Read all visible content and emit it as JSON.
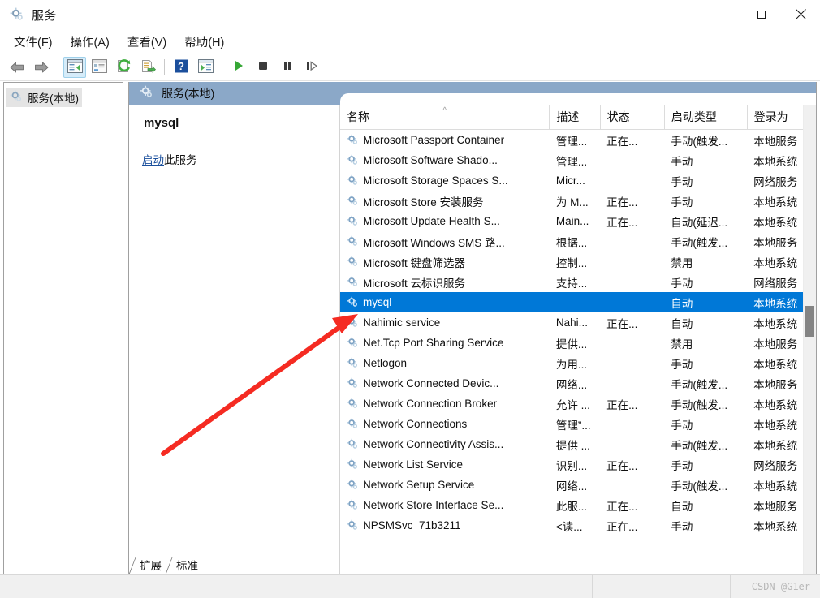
{
  "window": {
    "title": "服务",
    "icon": "services-gear-icon",
    "controls": {
      "minimize": "minimize-icon",
      "maximize": "maximize-icon",
      "close": "close-icon"
    }
  },
  "menubar": {
    "items": [
      {
        "label": "文件(F)",
        "name": "menu-file"
      },
      {
        "label": "操作(A)",
        "name": "menu-action"
      },
      {
        "label": "查看(V)",
        "name": "menu-view"
      },
      {
        "label": "帮助(H)",
        "name": "menu-help"
      }
    ]
  },
  "toolbar": {
    "buttons": [
      {
        "name": "back-button",
        "icon": "arrow-left-icon",
        "active": false
      },
      {
        "name": "forward-button",
        "icon": "arrow-right-icon",
        "active": false
      },
      {
        "name": "show-hide-tree-button",
        "icon": "console-tree-icon",
        "active": true
      },
      {
        "name": "properties-button",
        "icon": "properties-window-icon",
        "active": false
      },
      {
        "name": "refresh-button",
        "icon": "refresh-icon",
        "active": false
      },
      {
        "name": "export-list-button",
        "icon": "export-list-icon",
        "active": false
      },
      {
        "name": "help-button",
        "icon": "question-mark-icon",
        "active": false
      },
      {
        "name": "show-action-pane-button",
        "icon": "action-pane-icon",
        "active": false
      },
      {
        "name": "start-service-button",
        "icon": "play-icon",
        "active": false
      },
      {
        "name": "stop-service-button",
        "icon": "stop-icon",
        "active": false
      },
      {
        "name": "pause-service-button",
        "icon": "pause-icon",
        "active": false
      },
      {
        "name": "restart-service-button",
        "icon": "restart-icon",
        "active": false
      }
    ]
  },
  "tree": {
    "items": [
      {
        "label": "服务(本地)",
        "icon": "services-gear-icon",
        "selected": true
      }
    ]
  },
  "console": {
    "header_title": "服务(本地)",
    "header_icon": "services-gear-icon",
    "header_color": "#8ba8c8"
  },
  "details": {
    "service_name": "mysql",
    "action_link": "启动",
    "action_suffix": "此服务"
  },
  "table": {
    "columns": [
      {
        "label": "名称",
        "name": "column-name",
        "sorted": true
      },
      {
        "label": "描述",
        "name": "column-description",
        "sorted": false
      },
      {
        "label": "状态",
        "name": "column-status",
        "sorted": false
      },
      {
        "label": "启动类型",
        "name": "column-startup-type",
        "sorted": false
      },
      {
        "label": "登录为",
        "name": "column-log-on-as",
        "sorted": false
      }
    ],
    "sort_caret": "^",
    "rows": [
      {
        "name": "Microsoft Passport Container",
        "description": "管理...",
        "status": "正在...",
        "startup": "手动(触发...",
        "logon": "本地服务",
        "selected": false
      },
      {
        "name": "Microsoft Software Shado...",
        "description": "管理...",
        "status": "",
        "startup": "手动",
        "logon": "本地系统",
        "selected": false
      },
      {
        "name": "Microsoft Storage Spaces S...",
        "description": "Micr...",
        "status": "",
        "startup": "手动",
        "logon": "网络服务",
        "selected": false
      },
      {
        "name": "Microsoft Store 安装服务",
        "description": "为 M...",
        "status": "正在...",
        "startup": "手动",
        "logon": "本地系统",
        "selected": false
      },
      {
        "name": "Microsoft Update Health S...",
        "description": "Main...",
        "status": "正在...",
        "startup": "自动(延迟...",
        "logon": "本地系统",
        "selected": false
      },
      {
        "name": "Microsoft Windows SMS 路...",
        "description": "根据...",
        "status": "",
        "startup": "手动(触发...",
        "logon": "本地服务",
        "selected": false
      },
      {
        "name": "Microsoft 键盘筛选器",
        "description": "控制...",
        "status": "",
        "startup": "禁用",
        "logon": "本地系统",
        "selected": false
      },
      {
        "name": "Microsoft 云标识服务",
        "description": "支持...",
        "status": "",
        "startup": "手动",
        "logon": "网络服务",
        "selected": false
      },
      {
        "name": "mysql",
        "description": "",
        "status": "",
        "startup": "自动",
        "logon": "本地系统",
        "selected": true
      },
      {
        "name": "Nahimic service",
        "description": "Nahi...",
        "status": "正在...",
        "startup": "自动",
        "logon": "本地系统",
        "selected": false
      },
      {
        "name": "Net.Tcp Port Sharing Service",
        "description": "提供...",
        "status": "",
        "startup": "禁用",
        "logon": "本地服务",
        "selected": false
      },
      {
        "name": "Netlogon",
        "description": "为用...",
        "status": "",
        "startup": "手动",
        "logon": "本地系统",
        "selected": false
      },
      {
        "name": "Network Connected Devic...",
        "description": "网络...",
        "status": "",
        "startup": "手动(触发...",
        "logon": "本地服务",
        "selected": false
      },
      {
        "name": "Network Connection Broker",
        "description": "允许 ...",
        "status": "正在...",
        "startup": "手动(触发...",
        "logon": "本地系统",
        "selected": false
      },
      {
        "name": "Network Connections",
        "description": "管理”...",
        "status": "",
        "startup": "手动",
        "logon": "本地系统",
        "selected": false
      },
      {
        "name": "Network Connectivity Assis...",
        "description": "提供 ...",
        "status": "",
        "startup": "手动(触发...",
        "logon": "本地系统",
        "selected": false
      },
      {
        "name": "Network List Service",
        "description": "识别...",
        "status": "正在...",
        "startup": "手动",
        "logon": "网络服务",
        "selected": false
      },
      {
        "name": "Network Setup Service",
        "description": "网络...",
        "status": "",
        "startup": "手动(触发...",
        "logon": "本地系统",
        "selected": false
      },
      {
        "name": "Network Store Interface Se...",
        "description": "此服...",
        "status": "正在...",
        "startup": "自动",
        "logon": "本地服务",
        "selected": false
      },
      {
        "name": "NPSMSvc_71b3211",
        "description": "<读...",
        "status": "正在...",
        "startup": "手动",
        "logon": "本地系统",
        "selected": false
      }
    ]
  },
  "tabs": [
    {
      "label": "扩展",
      "name": "tab-extended",
      "active": false
    },
    {
      "label": "标准",
      "name": "tab-standard",
      "active": true
    }
  ],
  "statusbar": {
    "watermark": "CSDN @G1er"
  },
  "annotation": {
    "color": "#f52b22",
    "shape": "red-arrow-pointing-to-mysql-row"
  }
}
